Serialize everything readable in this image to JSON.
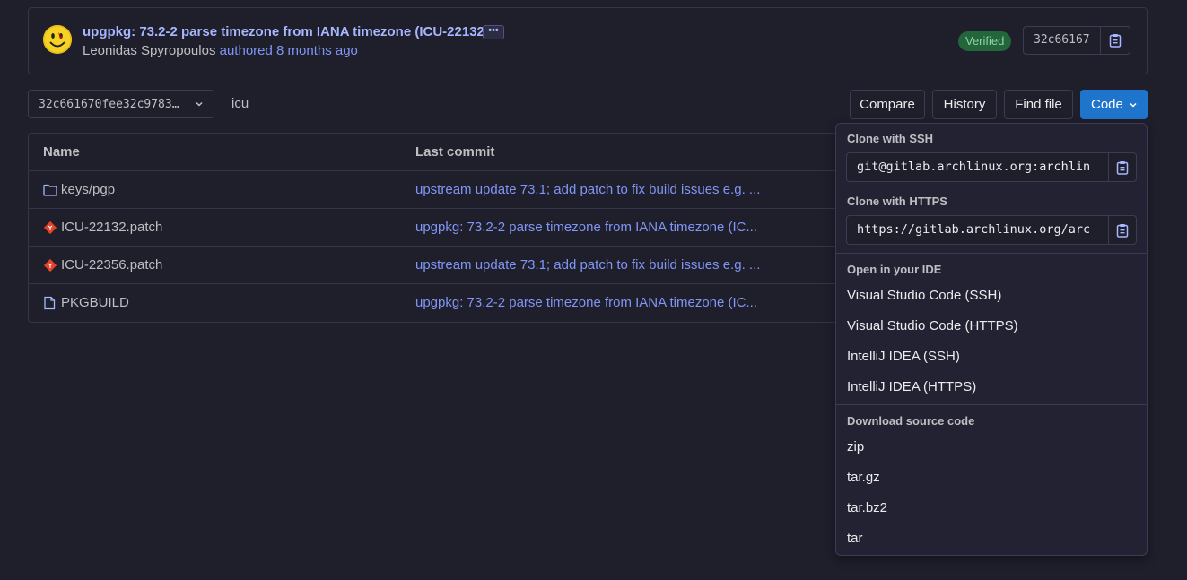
{
  "commit": {
    "title": "upgpkg: 73.2-2 parse timezone from IANA timezone (ICU-22132)",
    "ellipsis": "•••",
    "author": "Leonidas Spyropoulos",
    "meta": "authored 8 months ago",
    "verified_label": "Verified",
    "sha": "32c66167"
  },
  "toolbar": {
    "branch": "32c661670fee32c9783…",
    "breadcrumb": "icu",
    "compare": "Compare",
    "history": "History",
    "find_file": "Find file",
    "code": "Code"
  },
  "table": {
    "headers": {
      "name": "Name",
      "last_commit": "Last commit"
    },
    "rows": [
      {
        "name": "keys/pgp",
        "type": "folder",
        "commit": "upstream update 73.1; add patch to fix build issues e.g. ..."
      },
      {
        "name": "ICU-22132.patch",
        "type": "patch",
        "commit": "upgpkg: 73.2-2 parse timezone from IANA timezone (IC..."
      },
      {
        "name": "ICU-22356.patch",
        "type": "patch",
        "commit": "upstream update 73.1; add patch to fix build issues e.g. ..."
      },
      {
        "name": "PKGBUILD",
        "type": "file",
        "commit": "upgpkg: 73.2-2 parse timezone from IANA timezone (IC..."
      }
    ]
  },
  "dropdown": {
    "ssh_heading": "Clone with SSH",
    "ssh_url": "git@gitlab.archlinux.org:archlin",
    "https_heading": "Clone with HTTPS",
    "https_url": "https://gitlab.archlinux.org/arc",
    "ide_heading": "Open in your IDE",
    "ide_items": [
      "Visual Studio Code (SSH)",
      "Visual Studio Code (HTTPS)",
      "IntelliJ IDEA (SSH)",
      "IntelliJ IDEA (HTTPS)"
    ],
    "download_heading": "Download source code",
    "download_items": [
      "zip",
      "tar.gz",
      "tar.bz2",
      "tar"
    ]
  },
  "colors": {
    "background": "#1f1e2b",
    "link": "#8096f5",
    "primary_button": "#1f75cb",
    "verified_bg": "#24663b",
    "patch_icon": "#e24329"
  },
  "icons": {
    "copy": "clipboard-icon",
    "chevron": "chevron-down-icon",
    "folder": "folder-icon",
    "patch": "git-patch-icon",
    "file": "document-icon"
  }
}
